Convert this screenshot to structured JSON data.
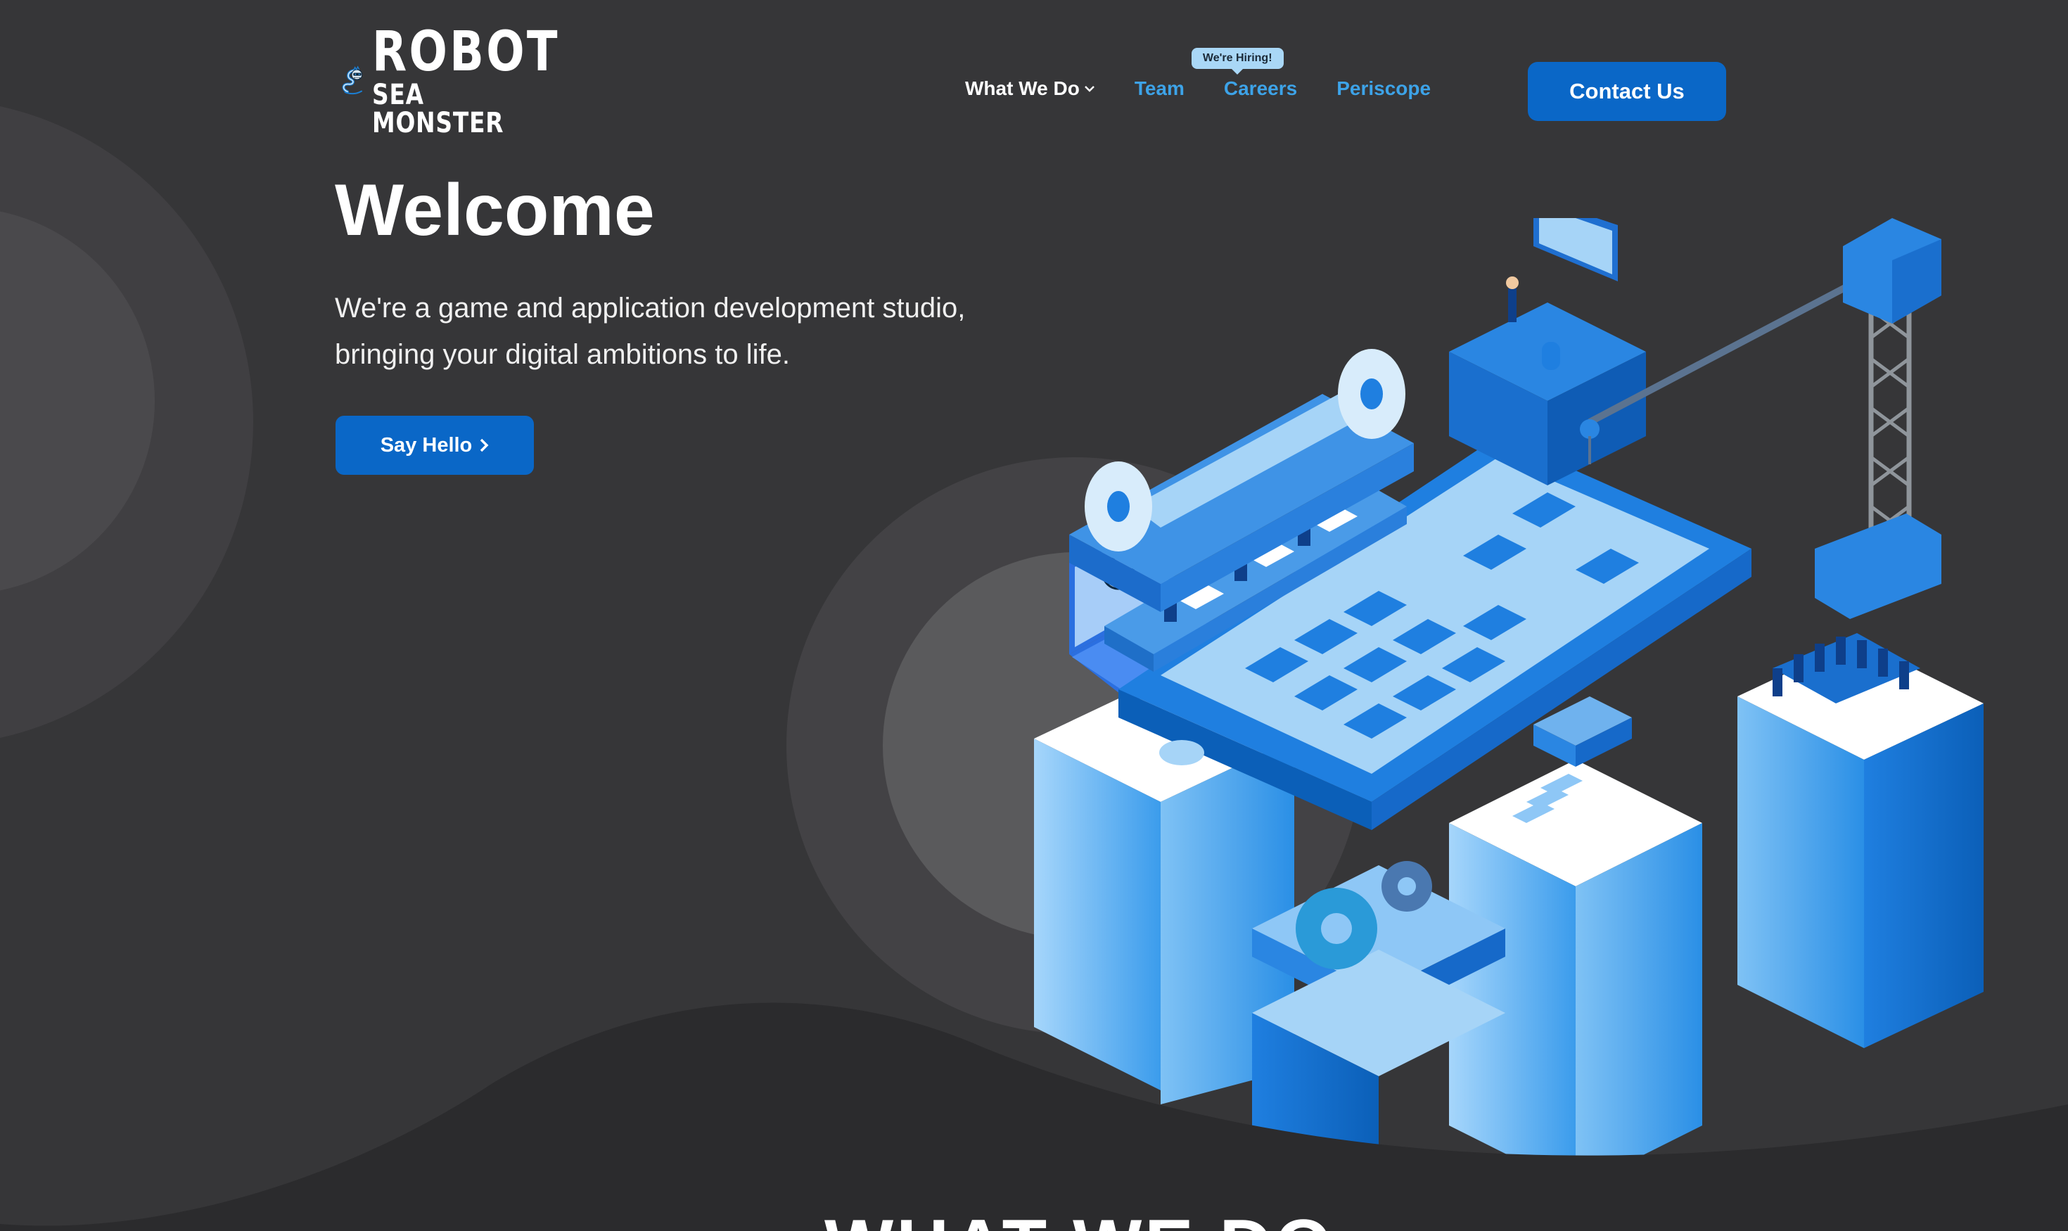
{
  "brand": {
    "name_line1": "ROBOT",
    "name_line2": "SEA MONSTER",
    "logo_icon": "sea-monster-mascot-icon"
  },
  "nav": {
    "items": [
      {
        "label": "What We Do",
        "has_dropdown": true
      },
      {
        "label": "Team"
      },
      {
        "label": "Careers",
        "badge": "We're Hiring!"
      },
      {
        "label": "Periscope"
      }
    ],
    "contact_label": "Contact Us"
  },
  "hero": {
    "title": "Welcome",
    "subtitle": "We're a game and application development studio, bringing your digital ambitions to life.",
    "cta_label": "Say Hello",
    "cta_icon": "chevron-right-icon"
  },
  "next_section": {
    "heading": "WHAT WE DO"
  },
  "colors": {
    "background": "#363638",
    "accent": "#0a67c7",
    "link": "#3da3e8",
    "badge": "#a9d7f6"
  }
}
